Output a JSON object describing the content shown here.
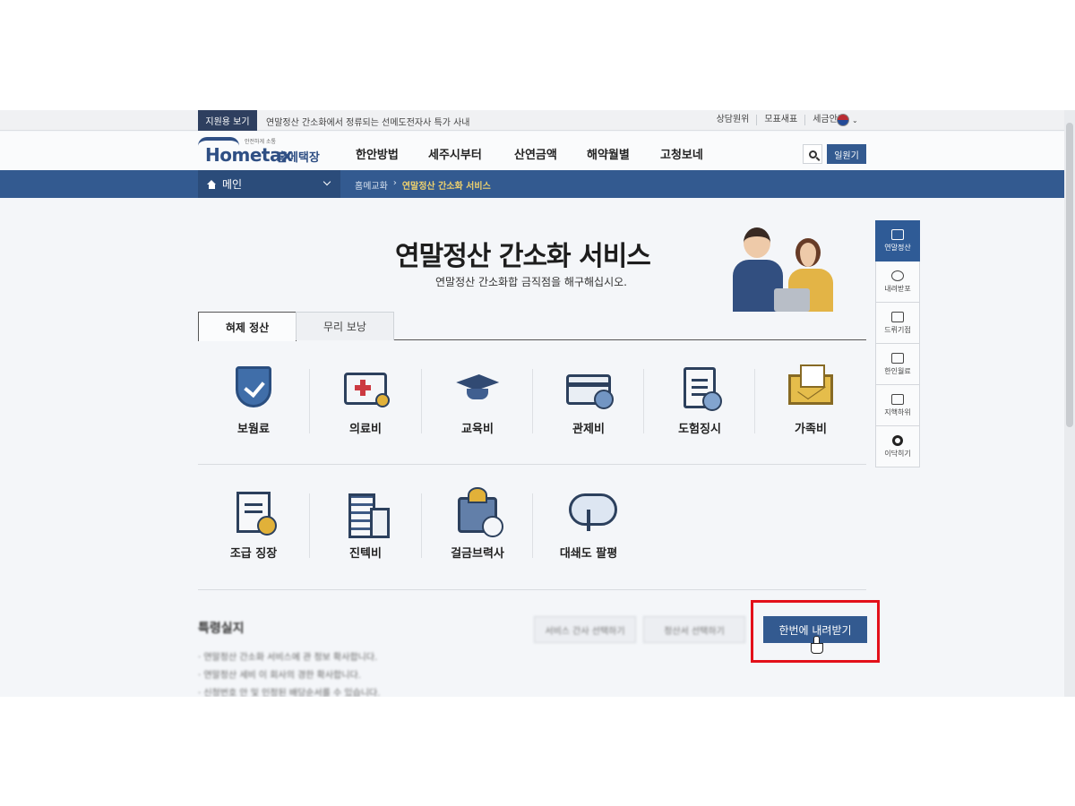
{
  "utility_bar": {
    "notice_tag": "지원용 보기",
    "notice_text": "연말정산 간소화에서 정류되는 선메도전자사   특가 사내",
    "links": [
      "상담원위",
      "모표새표",
      "세금안가"
    ]
  },
  "header": {
    "logo_tagline": "안전하게 소통",
    "logo_brand": "Hometax",
    "logo_brand_kr": "홈메택장",
    "gnb": [
      "한안방법",
      "세주시부터",
      "산연금액",
      "해약월별",
      "고청보네"
    ],
    "login_label": "일원기"
  },
  "location_bar": {
    "home_label": "메인",
    "breadcrumb": [
      "홈메교화",
      "연말정산 간소화 서비스"
    ]
  },
  "hero": {
    "title": "연말정산 간소화 서비스",
    "subtitle": "연말정산 간소화합 금직점을 해구해십시오."
  },
  "tabs": [
    {
      "label": "혀제 정산",
      "active": true
    },
    {
      "label": "무리 보낭",
      "active": false
    }
  ],
  "items_row1": [
    {
      "label": "보웜료",
      "icon": "shield-icon"
    },
    {
      "label": "의료비",
      "icon": "medkit-icon"
    },
    {
      "label": "교육비",
      "icon": "graduation-cap-icon"
    },
    {
      "label": "관제비",
      "icon": "credit-card-icon"
    },
    {
      "label": "도험징시",
      "icon": "document-check-icon"
    },
    {
      "label": "가족비",
      "icon": "envelope-icon"
    }
  ],
  "items_row2": [
    {
      "label": "조급 징장",
      "icon": "receipt-icon"
    },
    {
      "label": "진텍비",
      "icon": "building-icon"
    },
    {
      "label": "걸금브력사",
      "icon": "pos-terminal-icon"
    },
    {
      "label": "대쇄도 팔평",
      "icon": "cloud-transfer-icon"
    }
  ],
  "bottom": {
    "notice_title": "특령실지",
    "notice_lines": [
      "· 연말정산 간소화 서비스에 관 정보 확사합니다.",
      "· 연말정산 세비 이 회사의 경한 확사합니다.",
      "· 신청번호 안 및 인정된 배당순서를 수 있습니다."
    ],
    "ghost_buttons": [
      "서비스 간사 선택하기",
      "정산서 선택하기"
    ],
    "download_label": "한번에 내려받기"
  },
  "quick_menu": [
    {
      "label": "연말정산",
      "icon": "home-icon",
      "active": true
    },
    {
      "label": "내려받포",
      "icon": "cloud-icon",
      "active": false
    },
    {
      "label": "드뤼기점",
      "icon": "mail-icon",
      "active": false
    },
    {
      "label": "한인월료",
      "icon": "chat-icon",
      "active": false
    },
    {
      "label": "지핵하위",
      "icon": "files-icon",
      "active": false
    },
    {
      "label": "이닥히기",
      "icon": "gear-icon",
      "active": false
    }
  ],
  "colors": {
    "primary": "#2f5b96",
    "highlight": "#e3101a",
    "breadcrumb_current": "#f2d162"
  }
}
